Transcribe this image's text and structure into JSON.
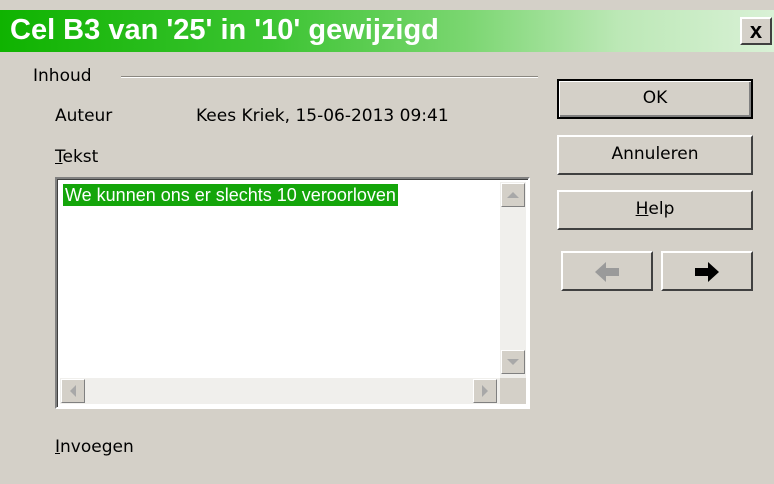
{
  "window": {
    "title": "Cel B3 van '25' in '10' gewijzigd",
    "close_label": "x"
  },
  "content": {
    "group_label": "Inhoud",
    "author_label": "Auteur",
    "author_value": "Kees Kriek, 15-06-2013 09:41",
    "text_label_first": "T",
    "text_label_rest": "ekst",
    "text_value": "We kunnen ons er slechts 10 veroorloven",
    "insert_label_first": "I",
    "insert_label_rest": "nvoegen"
  },
  "buttons": {
    "ok": "OK",
    "cancel": "Annuleren",
    "help_first": "H",
    "help_rest": "elp"
  },
  "navigation": {
    "previous_icon": "arrow-left-icon",
    "next_icon": "arrow-right-icon",
    "previous_enabled": false,
    "next_enabled": true
  },
  "colors": {
    "title_gradient_start": "#0fb300",
    "selection": "#14a50a",
    "dialog_bg": "#d4d0c8"
  }
}
